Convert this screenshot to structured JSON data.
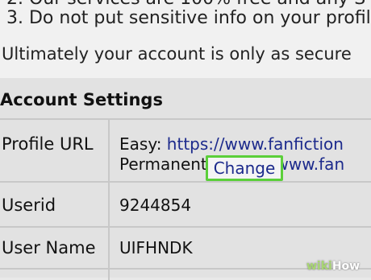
{
  "guidelines": {
    "rule2": "2.  Our services are 100% free and any S",
    "rule3": "3.  Do not put sensitive info on your profil",
    "ultimately": "Ultimately your account is only as secure"
  },
  "account_settings": {
    "title": "Account Settings",
    "profile_url": {
      "label": "Profile URL",
      "easy_prefix": "Easy: ",
      "easy_link": "https://www.fanfiction",
      "permanent_prefix": "Permanent: ",
      "permanent_link": "https://www.fan"
    },
    "userid": {
      "label": "Userid",
      "value": "9244854"
    },
    "user_name": {
      "label": "User Name",
      "value": "UIFHNDK",
      "change_label": "Change"
    }
  },
  "watermark": {
    "wiki": "wiki",
    "how": "How"
  },
  "colors": {
    "link": "#1c2a8c",
    "highlight_border": "#5bcf3a",
    "page_bg": "#e9e9e9"
  }
}
